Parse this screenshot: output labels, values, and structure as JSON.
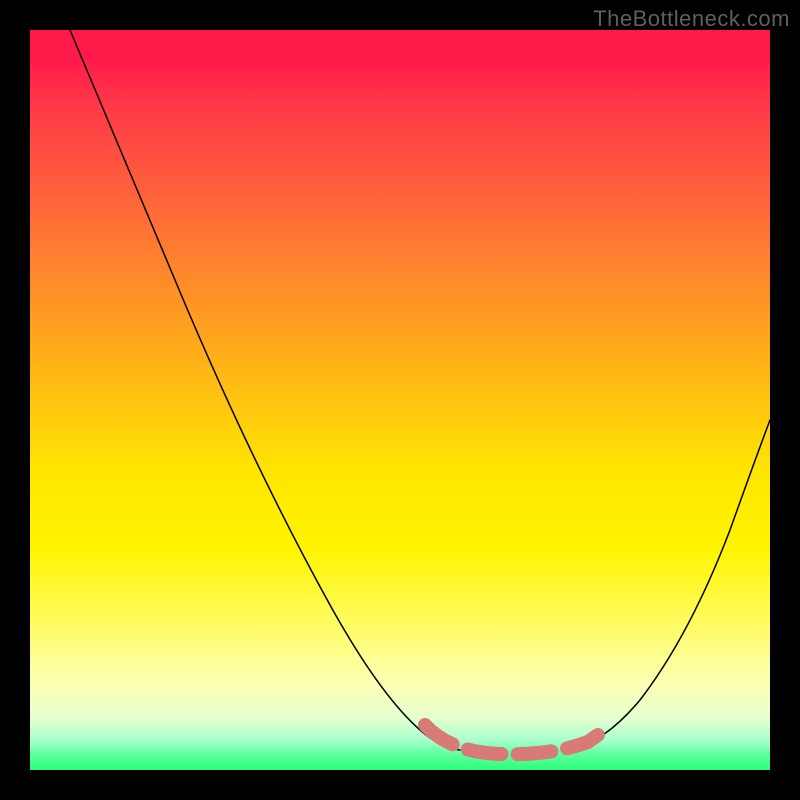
{
  "watermark": "TheBottleneck.com",
  "colors": {
    "frame_background": "#000000",
    "watermark_text": "#5f5f5f",
    "curve_stroke": "#000000",
    "highlight_stroke": "#d87a75",
    "gradient_top": "#ff1a4a",
    "gradient_mid": "#ffe600",
    "gradient_bottom": "#2dff7c"
  },
  "chart_data": {
    "type": "line",
    "title": "",
    "xlabel": "",
    "ylabel": "",
    "xlim": [
      0,
      100
    ],
    "ylim": [
      0,
      100
    ],
    "grid": false,
    "legend": false,
    "annotations": [],
    "x": [
      5,
      10,
      15,
      20,
      25,
      30,
      35,
      40,
      45,
      50,
      53,
      58,
      63,
      68,
      73,
      77,
      80,
      84,
      88,
      92,
      96,
      100
    ],
    "values": [
      100,
      92,
      84,
      75,
      66,
      57,
      48,
      39,
      30,
      20,
      12,
      5,
      2,
      2,
      2,
      3,
      6,
      14,
      24,
      34,
      42,
      48
    ],
    "highlight_range_x": [
      53,
      78
    ],
    "note": "x is normalized horizontal position (0=left edge of plot, 100=right); values are percentage height from bottom (0) to top (100). Values are estimated from pixel positions since the chart has no numeric axes."
  }
}
